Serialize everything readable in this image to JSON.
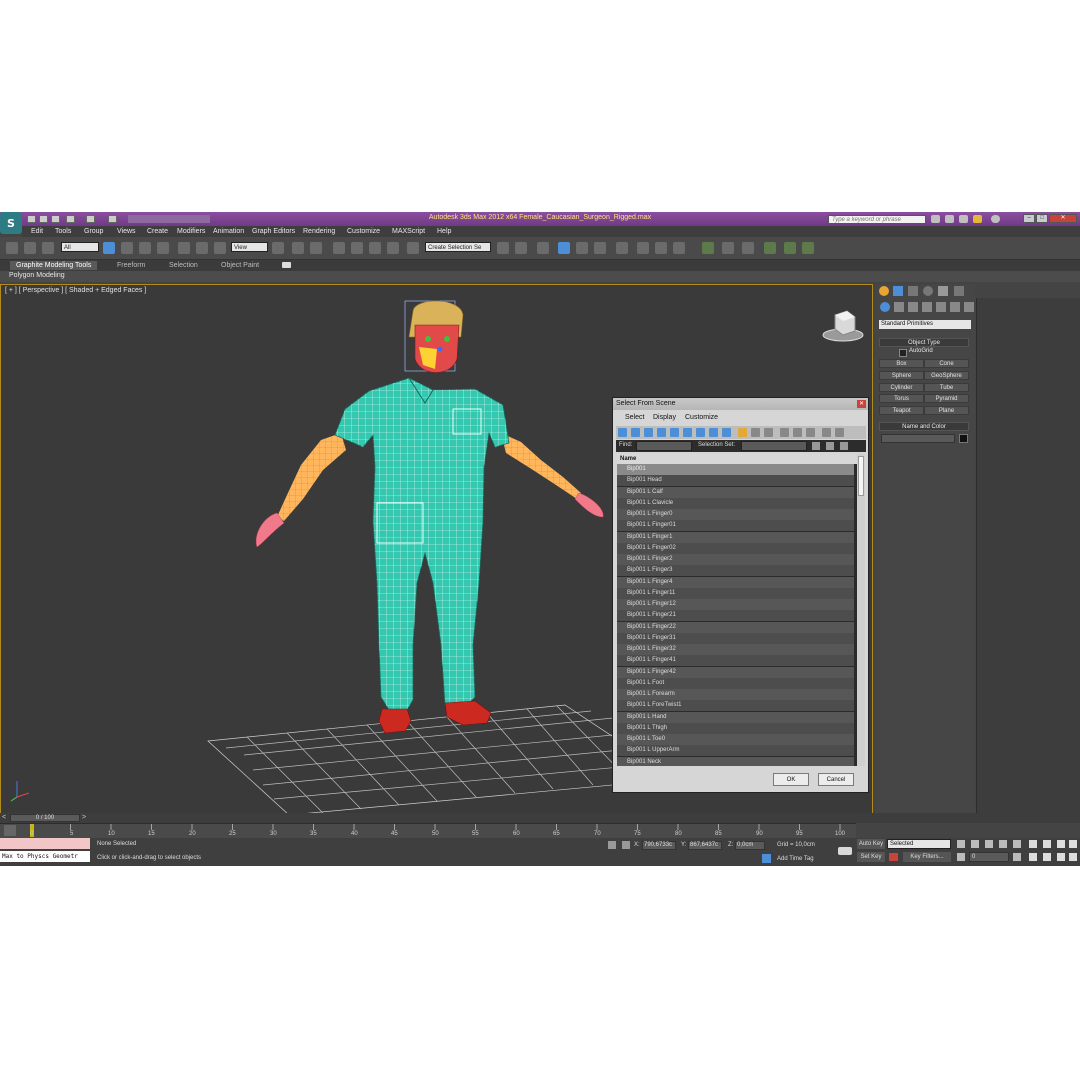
{
  "titlebar": {
    "title": "Autodesk 3ds Max  2012 x64     Female_Caucasian_Surgeon_Rigged.max",
    "search_placeholder": "Type a keyword or phrase"
  },
  "menubar": {
    "items": [
      "Edit",
      "Tools",
      "Group",
      "Views",
      "Create",
      "Modifiers",
      "Animation",
      "Graph Editors",
      "Rendering",
      "Customize",
      "MAXScript",
      "Help"
    ]
  },
  "maintoolbar": {
    "selection_filter": "All",
    "reference_coord": "View",
    "named_selection": "Create Selection Se"
  },
  "ribbon": {
    "tabs": [
      "Graphite Modeling Tools",
      "Freeform",
      "Selection",
      "Object Paint"
    ],
    "subtab": "Polygon Modeling"
  },
  "viewport": {
    "label": "[ + ] [ Perspective ] [ Shaded + Edged Faces ]"
  },
  "command_panel": {
    "category": "Standard Primitives",
    "object_type_title": "Object Type",
    "autogrid_label": "AutoGrid",
    "buttons": [
      "Box",
      "Cone",
      "Sphere",
      "GeoSphere",
      "Cylinder",
      "Tube",
      "Torus",
      "Pyramid",
      "Teapot",
      "Plane"
    ],
    "name_color_title": "Name and Color"
  },
  "dialog": {
    "title": "Select From Scene",
    "menu": [
      "Select",
      "Display",
      "Customize"
    ],
    "find_label": "Find:",
    "selection_set_label": "Selection Set:",
    "column_name": "Name",
    "items": [
      "Bip001",
      "Bip001 Head",
      "Bip001 L Calf",
      "Bip001 L Clavicle",
      "Bip001 L Finger0",
      "Bip001 L Finger01",
      "Bip001 L Finger1",
      "Bip001 L Finger02",
      "Bip001 L Finger2",
      "Bip001 L Finger3",
      "Bip001 L Finger4",
      "Bip001 L Finger11",
      "Bip001 L Finger12",
      "Bip001 L Finger21",
      "Bip001 L Finger22",
      "Bip001 L Finger31",
      "Bip001 L Finger32",
      "Bip001 L Finger41",
      "Bip001 L Finger42",
      "Bip001 L Foot",
      "Bip001 L Forearm",
      "Bip001 L ForeTwist1",
      "Bip001 L Hand",
      "Bip001 L Thigh",
      "Bip001 L Toe0",
      "Bip001 L UpperArm",
      "Bip001 Neck"
    ],
    "ok_label": "OK",
    "cancel_label": "Cancel"
  },
  "timeline": {
    "frame_display": "0 / 100",
    "ticks": [
      "0",
      "5",
      "10",
      "15",
      "20",
      "25",
      "30",
      "35",
      "40",
      "45",
      "50",
      "55",
      "60",
      "65",
      "70",
      "75",
      "80",
      "85",
      "90",
      "95",
      "100"
    ]
  },
  "status": {
    "maxscript_listener": "Max to Physcs Geometr",
    "selection_status": "None Selected",
    "prompt": "Click or click-and-drag to select objects",
    "x_label": "X:",
    "x_value": "790,6733c",
    "y_label": "Y:",
    "y_value": "867,6437c",
    "z_label": "Z:",
    "z_value": "0,0cm",
    "grid": "Grid = 10,0cm",
    "add_time_tag": "Add Time Tag",
    "auto_key": "Auto Key",
    "auto_key_mode": "Selected",
    "set_key": "Set Key",
    "key_filters": "Key Filters...",
    "current_frame": "0"
  },
  "colors": {
    "title_purple": "#7a4393",
    "title_text": "#ffe47a",
    "viewport_border": "#b38c1c",
    "scrubs_teal": "#35c8b0",
    "selection_blue": "#4d8fd6"
  }
}
